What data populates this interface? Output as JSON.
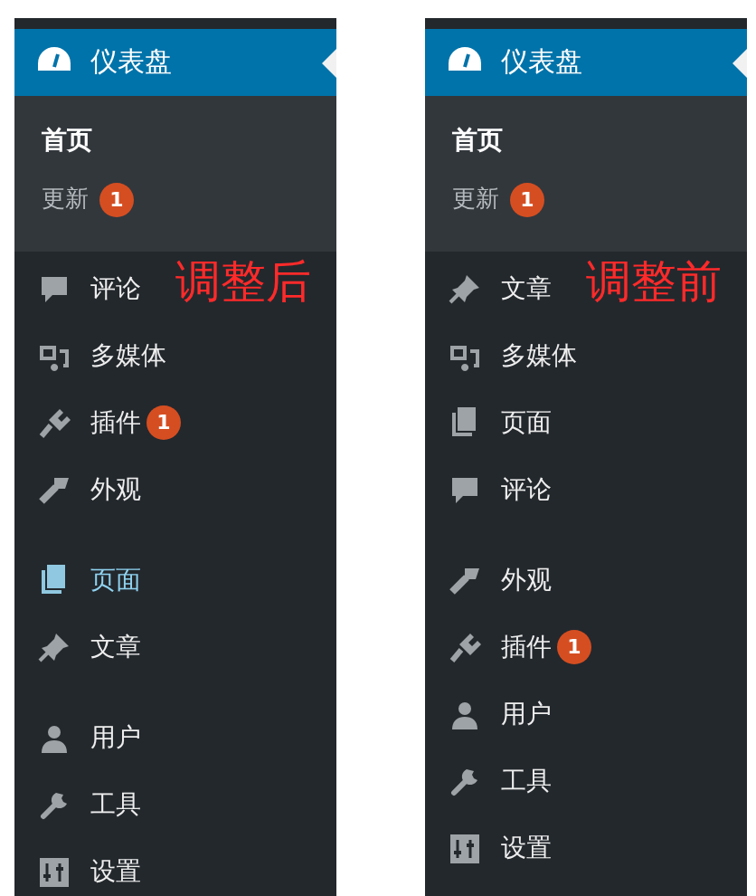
{
  "panels": [
    {
      "header": {
        "label": "仪表盘"
      },
      "submenu": [
        {
          "label": "首页",
          "selected": true
        },
        {
          "label": "更新",
          "selected": false,
          "badge": "1"
        }
      ],
      "annotation": "调整后",
      "menu": [
        {
          "kind": "comment",
          "label": "评论",
          "highlighted": false
        },
        {
          "kind": "media",
          "label": "多媒体",
          "highlighted": false
        },
        {
          "kind": "plugin",
          "label": "插件",
          "highlighted": false,
          "badge": "1"
        },
        {
          "kind": "appearance",
          "label": "外观",
          "highlighted": false
        },
        {
          "kind": "separator"
        },
        {
          "kind": "page",
          "label": "页面",
          "highlighted": true
        },
        {
          "kind": "post",
          "label": "文章",
          "highlighted": false
        },
        {
          "kind": "separator"
        },
        {
          "kind": "user",
          "label": "用户",
          "highlighted": false
        },
        {
          "kind": "tool",
          "label": "工具",
          "highlighted": false
        },
        {
          "kind": "settings",
          "label": "设置",
          "highlighted": false
        }
      ]
    },
    {
      "header": {
        "label": "仪表盘"
      },
      "submenu": [
        {
          "label": "首页",
          "selected": true
        },
        {
          "label": "更新",
          "selected": false,
          "badge": "1"
        }
      ],
      "annotation": "调整前",
      "menu": [
        {
          "kind": "post",
          "label": "文章",
          "highlighted": false
        },
        {
          "kind": "media",
          "label": "多媒体",
          "highlighted": false
        },
        {
          "kind": "page",
          "label": "页面",
          "highlighted": false
        },
        {
          "kind": "comment",
          "label": "评论",
          "highlighted": false
        },
        {
          "kind": "separator"
        },
        {
          "kind": "appearance",
          "label": "外观",
          "highlighted": false
        },
        {
          "kind": "plugin",
          "label": "插件",
          "highlighted": false,
          "badge": "1"
        },
        {
          "kind": "user",
          "label": "用户",
          "highlighted": false
        },
        {
          "kind": "tool",
          "label": "工具",
          "highlighted": false
        },
        {
          "kind": "settings",
          "label": "设置",
          "highlighted": false
        }
      ]
    }
  ]
}
